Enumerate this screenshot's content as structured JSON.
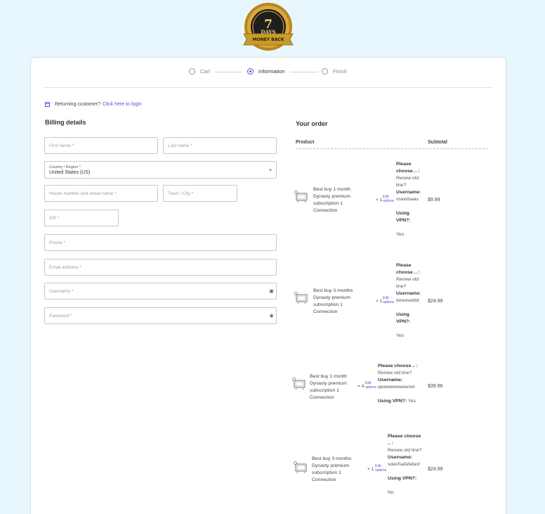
{
  "badge": {
    "top_text": "7",
    "middle_text": "DAYS",
    "bottom_text": "MONEY BACK"
  },
  "steps": [
    {
      "label": "Cart",
      "state": "pending"
    },
    {
      "label": "Information",
      "state": "active"
    },
    {
      "label": "Finish",
      "state": "pending"
    }
  ],
  "returning": {
    "text": "Returning customer?",
    "link": "Click here to login"
  },
  "billing": {
    "title": "Billing details",
    "first_name": "First name *",
    "last_name": "Last name *",
    "country_label": "Country / Region *",
    "country_value": "United States (US)",
    "street": "House number and street name *",
    "city": "Town / City *",
    "zip": "ZIP *",
    "phone": "Phone *",
    "email": "Email address *",
    "username": "Username *",
    "password": "Password *"
  },
  "order": {
    "title": "Your order",
    "col_product": "Product",
    "col_subtotal": "Subtotal",
    "items": [
      {
        "name": "Best buy 1 month Dynasty premium subscription 1 Connection",
        "qty": "× 1",
        "edit": "Edit options",
        "choose_label": "Please choose .. :",
        "choose_value": "Renew old line?",
        "username_label": "Username:",
        "username_value": "xsaxdsaas",
        "vpn_label": "Using VPN?:",
        "vpn_value": "Yes",
        "price": "$9.99"
      },
      {
        "name": "Best buy 3 months Dynasty premium subscription 1 Connection",
        "qty": "× 1",
        "edit": "Edit options",
        "choose_label": "Please choose .. :",
        "choose_value": "Renew old line?",
        "username_label": "Username:",
        "username_value": "dowewddd",
        "vpn_label": "Using VPN?:",
        "vpn_value": "Yes",
        "price": "$24.99"
      },
      {
        "name": "Best buy 1 month Dynasty premium subscription 1 Connection",
        "qty": "× 4",
        "edit": "Edit options",
        "choose_label": "Please choose .. :",
        "choose_value": "Renew old line?",
        "username_label": "Username:",
        "username_value": "qwewewweewrwr",
        "vpn_label": "Using VPN?:",
        "vpn_value": "Yes",
        "price": "$39.96"
      },
      {
        "name": "Best buy 3 months Dynasty premium subscription 1 Connection",
        "qty": "× 1",
        "edit": "Edit options",
        "choose_label": "Please choose .. :",
        "choose_value": "Renew old line?",
        "username_label": "Username:",
        "username_value": "sdasfsafafafasf",
        "vpn_label": "Using VPN?:",
        "vpn_value": "No",
        "price": "$24.99"
      }
    ]
  },
  "colors": {
    "accent": "#6b47d6",
    "background": "#e8f7fd",
    "gold": "#c89b2c"
  }
}
